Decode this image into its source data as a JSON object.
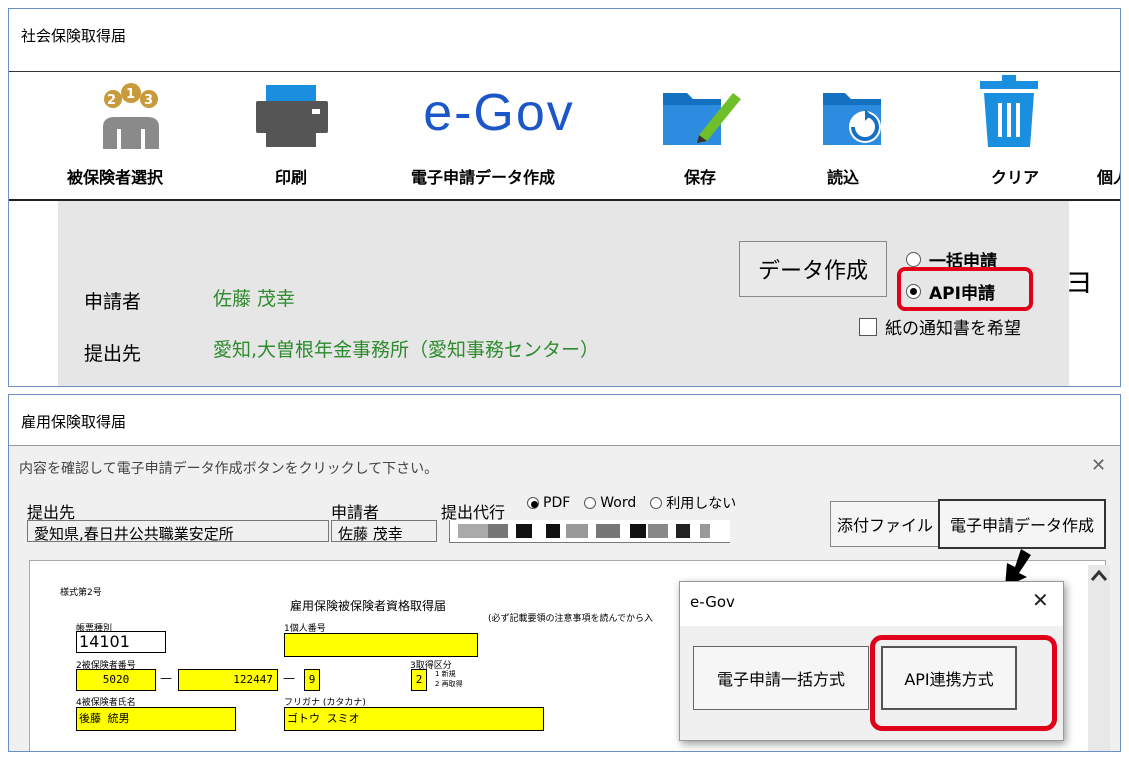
{
  "top_window": {
    "title": "社会保険取得届",
    "toolbar": [
      {
        "label": "被保険者選択",
        "icon": "insured-select-icon"
      },
      {
        "label": "印刷",
        "icon": "printer-icon"
      },
      {
        "label": "電子申請データ作成",
        "icon": "egov-logo",
        "logo_text": "e-Gov"
      },
      {
        "label": "保存",
        "icon": "folder-save-icon"
      },
      {
        "label": "読込",
        "icon": "folder-load-icon"
      },
      {
        "label": "クリア",
        "icon": "trash-icon"
      },
      {
        "label": "個人"
      }
    ],
    "applicant_label": "申請者",
    "applicant_value": "佐藤 茂幸",
    "submit_label": "提出先",
    "submit_value": "愛知,大曽根年金事務所（愛知事務センター）",
    "data_button": "データ作成",
    "radio_options": [
      {
        "label": "一括申請",
        "selected": false
      },
      {
        "label": "API申請",
        "selected": true
      }
    ],
    "checkbox_label": "紙の通知書を希望",
    "edge_glyph": "ヨ"
  },
  "bottom_window": {
    "title": "雇用保険取得届",
    "instruction": "内容を確認して電子申請データ作成ボタンをクリックして下さい。",
    "close_glyph": "✕",
    "submit_label": "提出先",
    "submit_value": "愛知県,春日井公共職業安定所",
    "applicant_label": "申請者",
    "applicant_value": "佐藤 茂幸",
    "proxy_label": "提出代行",
    "output_options": [
      {
        "label": "PDF",
        "selected": true
      },
      {
        "label": "Word",
        "selected": false
      },
      {
        "label": "利用しない",
        "selected": false
      }
    ],
    "attach_button": "添付ファイル",
    "create_button": "電子申請データ作成",
    "form": {
      "form_no": "様式第2号",
      "title": "雇用保険被保険者資格取得届",
      "note": "(必ず記載要領の注意事項を読んでから入",
      "f1_label": "帳票種別",
      "f1_value": "14101",
      "f2_label": "1個人番号",
      "f3_label": "2被保険者番号",
      "f3_a": "5020",
      "f3_b": "122447",
      "f3_c": "9",
      "f4_label": "3取得区分",
      "f4_value": "2",
      "f4_opt1": "1 新規",
      "f4_opt2": "2 再取得",
      "f5_label": "4被保険者氏名",
      "f5_value": "後藤 統男",
      "f6_label": "フリガナ (カタカナ)",
      "f6_value": "ゴトウ スミオ"
    },
    "dialog": {
      "title": "e-Gov",
      "close_glyph": "✕",
      "buttons": [
        "電子申請一括方式",
        "API連携方式"
      ]
    }
  },
  "colors": {
    "green_text": "#2e8b2e",
    "highlight_red": "#e0001a",
    "egov_blue": "#1b57c9",
    "form_yellow": "#ffff00"
  }
}
